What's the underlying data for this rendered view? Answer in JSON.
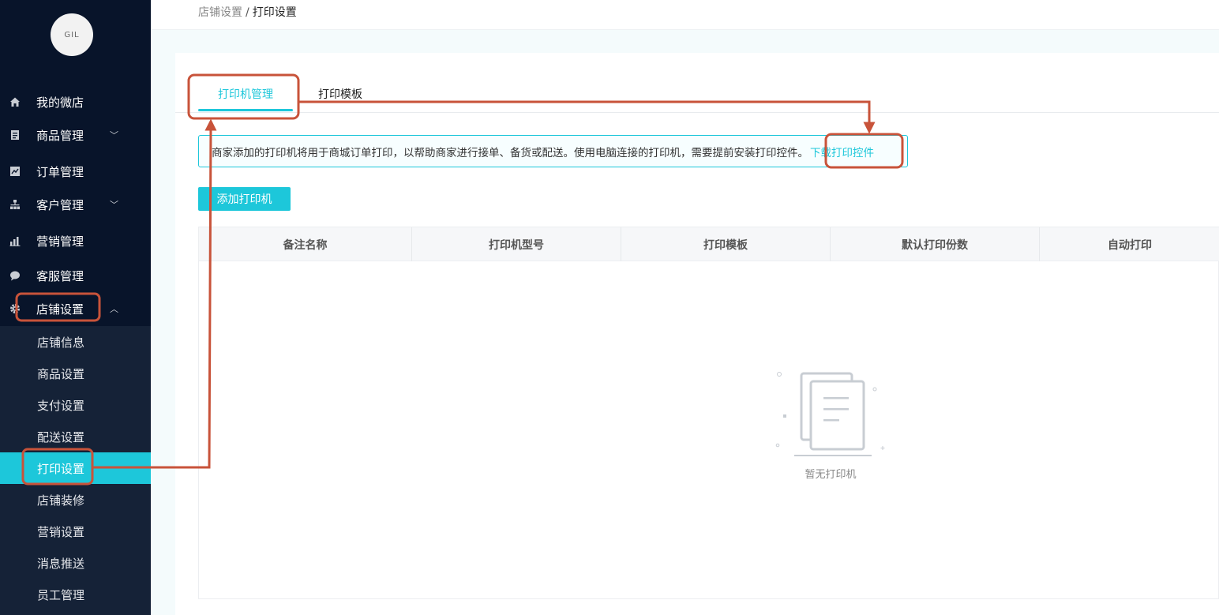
{
  "sidebar": {
    "logo_text": "GIL",
    "items": [
      {
        "label": "我的微店",
        "icon": "home-icon"
      },
      {
        "label": "商品管理",
        "icon": "document-icon",
        "caret": "﹀"
      },
      {
        "label": "订单管理",
        "icon": "chart-icon"
      },
      {
        "label": "客户管理",
        "icon": "org-icon",
        "caret": "﹀"
      },
      {
        "label": "营销管理",
        "icon": "bar-chart-icon"
      },
      {
        "label": "客服管理",
        "icon": "chat-icon"
      },
      {
        "label": "店铺设置",
        "icon": "gear-icon",
        "caret": "︿"
      }
    ],
    "submenu": [
      {
        "label": "店铺信息"
      },
      {
        "label": "商品设置"
      },
      {
        "label": "支付设置"
      },
      {
        "label": "配送设置"
      },
      {
        "label": "打印设置"
      },
      {
        "label": "店铺装修"
      },
      {
        "label": "营销设置"
      },
      {
        "label": "消息推送"
      },
      {
        "label": "员工管理"
      }
    ]
  },
  "breadcrumb": {
    "parent": "店铺设置",
    "sep": "/",
    "current": "打印设置"
  },
  "tabs": [
    {
      "label": "打印机管理"
    },
    {
      "label": "打印模板"
    }
  ],
  "notice": {
    "text": "商家添加的打印机将用于商城订单打印，以帮助商家进行接单、备货或配送。使用电脑连接的打印机，需要提前安装打印控件。",
    "link": "下载打印控件"
  },
  "add_button": "添加打印机",
  "table": {
    "columns": [
      "备注名称",
      "打印机型号",
      "打印模板",
      "默认打印份数",
      "自动打印"
    ],
    "empty_text": "暂无打印机"
  },
  "colors": {
    "accent": "#1dc7da",
    "sidebar_bg": "#08142a",
    "submenu_bg": "#152237",
    "annotation": "#c8533a"
  }
}
